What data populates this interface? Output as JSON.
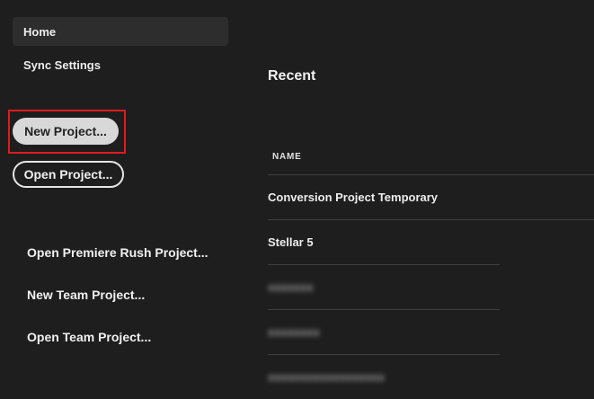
{
  "sidebar": {
    "nav": [
      {
        "label": "Home"
      },
      {
        "label": "Sync Settings"
      }
    ],
    "buttons": {
      "new_project": "New Project...",
      "open_project": "Open Project..."
    },
    "links": [
      {
        "label": "Open Premiere Rush Project..."
      },
      {
        "label": "New Team Project..."
      },
      {
        "label": "Open Team Project..."
      }
    ]
  },
  "main": {
    "section_title": "Recent",
    "column_header": "NAME",
    "rows": [
      {
        "name": "Conversion Project Temporary"
      },
      {
        "name": "Stellar 5"
      },
      {
        "name": "xxxxxxx"
      },
      {
        "name": "xxxxxxxx"
      },
      {
        "name": "xxxxxxxxxxxxxxxxxx"
      }
    ]
  },
  "colors": {
    "background": "#1e1e1e",
    "active_nav": "#2d2d2d",
    "primary_button": "#d8d8d8",
    "highlight": "#e01b1b"
  }
}
